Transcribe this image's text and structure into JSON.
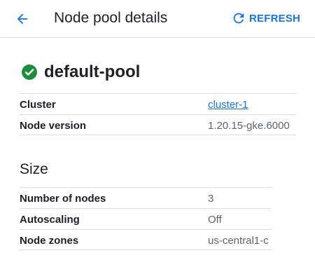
{
  "header": {
    "title": "Node pool details",
    "back_icon": "arrow-left-icon",
    "refresh_label": "REFRESH",
    "refresh_icon": "refresh-icon",
    "accent_color": "#1a73e8"
  },
  "pool": {
    "name": "default-pool",
    "status_icon": "check-circle-icon",
    "status_color": "#1e8e3e"
  },
  "details": [
    {
      "label": "Cluster",
      "value": "cluster-1",
      "is_link": true
    },
    {
      "label": "Node version",
      "value": "1.20.15-gke.6000",
      "is_link": false
    }
  ],
  "size": {
    "title": "Size",
    "rows": [
      {
        "label": "Number of nodes",
        "value": "3"
      },
      {
        "label": "Autoscaling",
        "value": "Off"
      },
      {
        "label": "Node zones",
        "value": "us-central1-c"
      }
    ]
  }
}
